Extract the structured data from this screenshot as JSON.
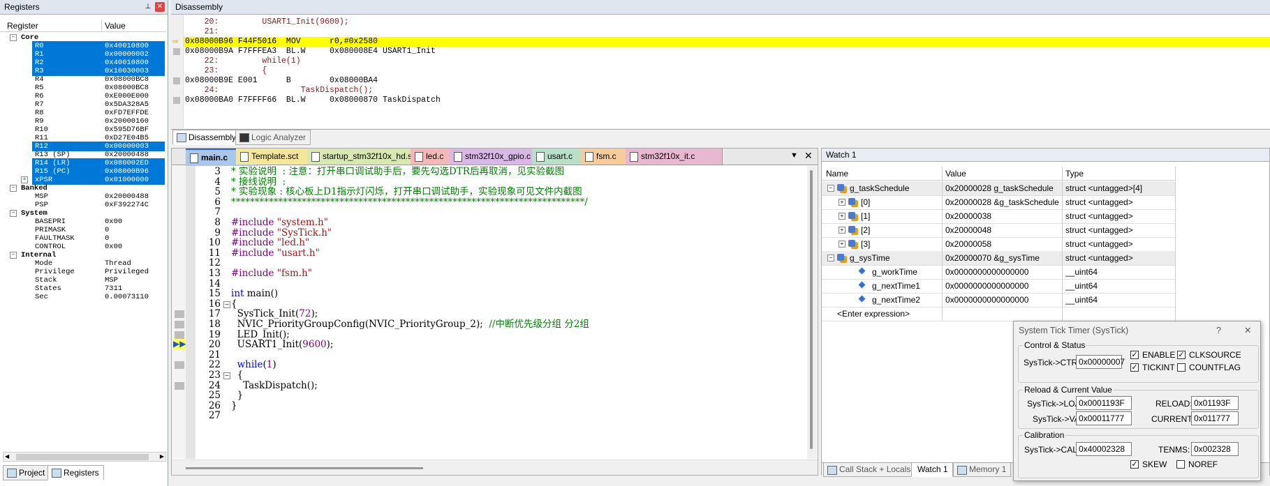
{
  "registers": {
    "title": "Registers",
    "col_register": "Register",
    "col_value": "Value",
    "groups": {
      "core": "Core",
      "banked": "Banked",
      "system": "System",
      "internal": "Internal"
    },
    "core": [
      {
        "name": "R0",
        "value": "0x40010800",
        "sel": true
      },
      {
        "name": "R1",
        "value": "0x00000002",
        "sel": true
      },
      {
        "name": "R2",
        "value": "0x40010800",
        "sel": true
      },
      {
        "name": "R3",
        "value": "0x10030003",
        "sel": true
      },
      {
        "name": "R4",
        "value": "0x08000BC8",
        "sel": false
      },
      {
        "name": "R5",
        "value": "0x08000BC8",
        "sel": false
      },
      {
        "name": "R6",
        "value": "0xE000E000",
        "sel": false
      },
      {
        "name": "R7",
        "value": "0x5DA328A5",
        "sel": false
      },
      {
        "name": "R8",
        "value": "0xFD7EFFDE",
        "sel": false
      },
      {
        "name": "R9",
        "value": "0x20000160",
        "sel": false
      },
      {
        "name": "R10",
        "value": "0x595D76BF",
        "sel": false
      },
      {
        "name": "R11",
        "value": "0xD27E04B5",
        "sel": false
      },
      {
        "name": "R12",
        "value": "0x00000003",
        "sel": true
      },
      {
        "name": "R13 (SP)",
        "value": "0x20000488",
        "sel": false
      },
      {
        "name": "R14 (LR)",
        "value": "0x080002ED",
        "sel": true
      },
      {
        "name": "R15 (PC)",
        "value": "0x08000B96",
        "sel": true
      },
      {
        "name": "xPSR",
        "value": "0x01000000",
        "sel": true
      }
    ],
    "banked": [
      {
        "name": "MSP",
        "value": "0x20000488"
      },
      {
        "name": "PSP",
        "value": "0xF392274C"
      }
    ],
    "system": [
      {
        "name": "BASEPRI",
        "value": "0x00"
      },
      {
        "name": "PRIMASK",
        "value": "0"
      },
      {
        "name": "FAULTMASK",
        "value": "0"
      },
      {
        "name": "CONTROL",
        "value": "0x00"
      }
    ],
    "internal": [
      {
        "name": "Mode",
        "value": "Thread"
      },
      {
        "name": "Privilege",
        "value": "Privileged"
      },
      {
        "name": "Stack",
        "value": "MSP"
      },
      {
        "name": "States",
        "value": "7311"
      },
      {
        "name": "Sec",
        "value": "0.00073110"
      }
    ],
    "tabs": [
      "Project",
      "Registers"
    ]
  },
  "disassembly": {
    "title": "Disassembly",
    "lines": [
      {
        "text": "    20:         USART1_Init(9600);",
        "kind": "src"
      },
      {
        "text": "    21: ",
        "kind": "src"
      },
      {
        "text": "0x08000B96 F44F5016  MOV      r0,#0x2580",
        "kind": "cur"
      },
      {
        "text": "0x08000B9A F7FFFEA3  BL.W     0x080008E4 USART1_Init",
        "kind": "asm"
      },
      {
        "text": "    22:         while(1)",
        "kind": "src"
      },
      {
        "text": "    23:         {",
        "kind": "src"
      },
      {
        "text": "0x08000B9E E001      B        0x08000BA4",
        "kind": "asm"
      },
      {
        "text": "    24:                 TaskDispatch();",
        "kind": "src"
      },
      {
        "text": "0x08000BA0 F7FFFF66  BL.W     0x08000870 TaskDispatch",
        "kind": "asm"
      }
    ],
    "tabs": [
      "Disassembly",
      "Logic Analyzer"
    ]
  },
  "editor": {
    "tabs": [
      {
        "label": "main.c",
        "color": "#a9c7ea",
        "active": true
      },
      {
        "label": "Template.sct",
        "color": "#f5e79a"
      },
      {
        "label": "startup_stm32f10x_hd.s",
        "color": "#d8e8b0"
      },
      {
        "label": "led.c",
        "color": "#f5b8b8"
      },
      {
        "label": "stm32f10x_gpio.c",
        "color": "#d9b8e8"
      },
      {
        "label": "usart.c",
        "color": "#b8e0c8"
      },
      {
        "label": "fsm.c",
        "color": "#f8cc99"
      },
      {
        "label": "stm32f10x_it.c",
        "color": "#e8b8d0"
      }
    ],
    "lines": [
      {
        "n": "3",
        "parts": [
          [
            "* 实验说明  : 注意：打开串口调试助手后，要先勾选DTR后再取消，见实验截图",
            "green"
          ]
        ]
      },
      {
        "n": "4",
        "parts": [
          [
            "* 接线说明  :",
            "green"
          ]
        ]
      },
      {
        "n": "5",
        "parts": [
          [
            "* 实验现象 : 核心板上D1指示灯闪烁，打开串口调试助手，实验现象可见文件内截图",
            "green"
          ]
        ]
      },
      {
        "n": "6",
        "parts": [
          [
            "***************************************************************************/",
            "green"
          ]
        ]
      },
      {
        "n": "7",
        "parts": []
      },
      {
        "n": "8",
        "parts": [
          [
            "#include ",
            "purple"
          ],
          [
            "\"system.h\"",
            "dkred"
          ]
        ]
      },
      {
        "n": "9",
        "parts": [
          [
            "#include ",
            "purple"
          ],
          [
            "\"SysTick.h\"",
            "dkred"
          ]
        ]
      },
      {
        "n": "10",
        "parts": [
          [
            "#include ",
            "purple"
          ],
          [
            "\"led.h\"",
            "dkred"
          ]
        ]
      },
      {
        "n": "11",
        "parts": [
          [
            "#include ",
            "purple"
          ],
          [
            "\"usart.h\"",
            "dkred"
          ]
        ]
      },
      {
        "n": "12",
        "parts": []
      },
      {
        "n": "13",
        "parts": [
          [
            "#include ",
            "purple"
          ],
          [
            "\"fsm.h\"",
            "dkred"
          ]
        ]
      },
      {
        "n": "14",
        "parts": []
      },
      {
        "n": "15",
        "parts": [
          [
            "int",
            "blue"
          ],
          [
            " main()",
            ""
          ]
        ]
      },
      {
        "n": "16",
        "parts": [
          [
            "{",
            ""
          ]
        ]
      },
      {
        "n": "17",
        "parts": [
          [
            "  SysTick_Init(",
            ""
          ],
          [
            "72",
            "purple"
          ],
          [
            ");",
            ""
          ]
        ]
      },
      {
        "n": "18",
        "parts": [
          [
            "  NVIC_PriorityGroupConfig(NVIC_PriorityGroup_2);  ",
            ""
          ],
          [
            "//中断优先级分组 分2组",
            "green"
          ]
        ]
      },
      {
        "n": "19",
        "parts": [
          [
            "  LED_Init();",
            ""
          ]
        ]
      },
      {
        "n": "20",
        "parts": [
          [
            "  USART1_Init(",
            ""
          ],
          [
            "9600",
            "purple"
          ],
          [
            ");",
            ""
          ]
        ]
      },
      {
        "n": "21",
        "parts": []
      },
      {
        "n": "22",
        "parts": [
          [
            "  ",
            ""
          ],
          [
            "while",
            "blue"
          ],
          [
            "(",
            ""
          ],
          [
            "1",
            "purple"
          ],
          [
            ")",
            ""
          ]
        ]
      },
      {
        "n": "23",
        "parts": [
          [
            "  {",
            ""
          ]
        ]
      },
      {
        "n": "24",
        "parts": [
          [
            "    TaskDispatch();",
            ""
          ]
        ]
      },
      {
        "n": "25",
        "parts": [
          [
            "  }",
            ""
          ]
        ]
      },
      {
        "n": "26",
        "parts": [
          [
            "}",
            ""
          ]
        ]
      },
      {
        "n": "27",
        "parts": []
      }
    ]
  },
  "watch": {
    "title": "Watch 1",
    "col_name": "Name",
    "col_value": "Value",
    "col_type": "Type",
    "rows": [
      {
        "name": "g_taskSchedule",
        "value": "0x20000028 g_taskSchedule",
        "type": "struct <untagged>[4]",
        "indent": 0,
        "exp": "-",
        "ico": "struct"
      },
      {
        "name": "[0]",
        "value": "0x20000028 &g_taskSchedule",
        "type": "struct <untagged>",
        "indent": 1,
        "exp": "+",
        "ico": "struct"
      },
      {
        "name": "[1]",
        "value": "0x20000038",
        "type": "struct <untagged>",
        "indent": 1,
        "exp": "+",
        "ico": "struct"
      },
      {
        "name": "[2]",
        "value": "0x20000048",
        "type": "struct <untagged>",
        "indent": 1,
        "exp": "+",
        "ico": "struct"
      },
      {
        "name": "[3]",
        "value": "0x20000058",
        "type": "struct <untagged>",
        "indent": 1,
        "exp": "+",
        "ico": "struct"
      },
      {
        "name": "g_sysTime",
        "value": "0x20000070 &g_sysTime",
        "type": "struct <untagged>",
        "indent": 0,
        "exp": "-",
        "ico": "struct"
      },
      {
        "name": "g_workTime",
        "value": "0x0000000000000000",
        "type": "__uint64",
        "indent": 2,
        "exp": "",
        "ico": "var"
      },
      {
        "name": "g_nextTime1",
        "value": "0x0000000000000000",
        "type": "__uint64",
        "indent": 2,
        "exp": "",
        "ico": "var"
      },
      {
        "name": "g_nextTime2",
        "value": "0x0000000000000000",
        "type": "__uint64",
        "indent": 2,
        "exp": "",
        "ico": "var"
      },
      {
        "name": "<Enter expression>",
        "value": "",
        "type": "",
        "indent": 0,
        "exp": "",
        "ico": ""
      }
    ],
    "tabs": [
      "Call Stack + Locals",
      "Watch 1",
      "Memory 1"
    ]
  },
  "systick": {
    "title": "System Tick Timer (SysTick)",
    "help": "?",
    "close": "✕",
    "control_status": "Control & Status",
    "ctrl_label": "SysTick->CTRL:",
    "ctrl_value": "0x00000007",
    "enable": "ENABLE",
    "clksource": "CLKSOURCE",
    "tickint": "TICKINT",
    "countflag": "COUNTFLAG",
    "reload_current": "Reload & Current Value",
    "load_label": "SysTick->LOAD:",
    "load_value": "0x0001193F",
    "reload_label": "RELOAD:",
    "reload_value": "0x01193F",
    "val_label": "SysTick->VAL:",
    "val_value": "0x00011777",
    "current_label": "CURRENT:",
    "current_value": "0x011777",
    "calibration": "Calibration",
    "calib_label": "SysTick->CALIB:",
    "calib_value": "0x40002328",
    "tenms_label": "TENMS:",
    "tenms_value": "0x002328",
    "skew": "SKEW",
    "noref": "NOREF"
  }
}
